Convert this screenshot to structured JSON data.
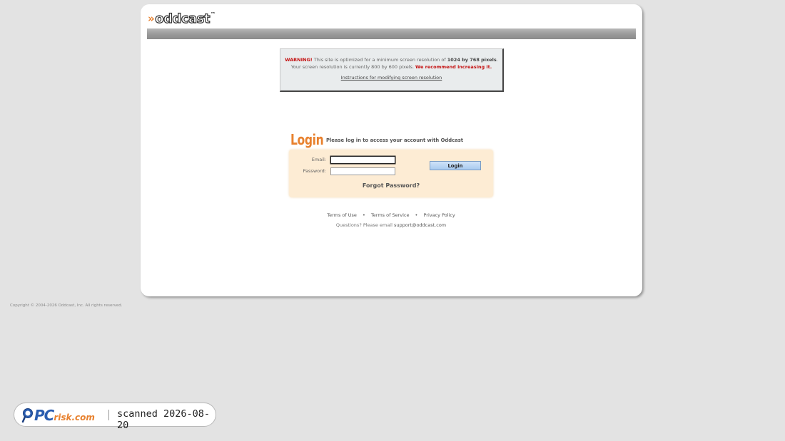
{
  "brand": {
    "chevron": "»",
    "logo_text": "oddcast",
    "trademark": "™",
    "accent_color": "#e8812e"
  },
  "warning": {
    "label": "WARNING!",
    "text_a": "This site is optimized for a minimum screen resolution of",
    "resolution": "1024 by 768 pixels",
    "text_b": ".",
    "text_c": "Your screen resolution is currently 800 by 600 pixels.",
    "recommend": "We recommend increasing it.",
    "link": "Instructions for modifying screen resolution"
  },
  "login": {
    "title": "Login",
    "subtitle": "Please log in to access your account with Oddcast",
    "email_label": "Email:",
    "email_value": "",
    "password_label": "Password:",
    "password_value": "",
    "button": "Login",
    "forgot": "Forgot Password?"
  },
  "footer": {
    "links": [
      "Terms of Use",
      "Terms of Service",
      "Privacy Policy"
    ],
    "separator": "•",
    "questions": "Questions? Please email",
    "email": "support@oddcast.com",
    "copyright": "Copyright © 2004-2026 Oddcast, Inc. All rights reserved."
  },
  "scan_badge": {
    "logo_pc": "PC",
    "logo_risk": "risk.com",
    "text": "scanned 2026-08-20"
  }
}
